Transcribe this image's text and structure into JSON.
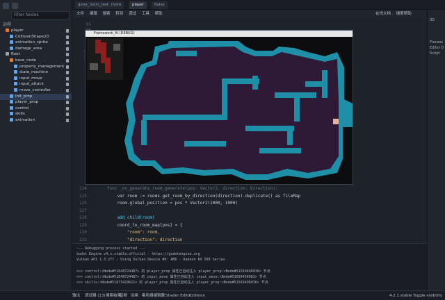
{
  "scene_panel": {
    "filter_placeholder": "Filter Nodes",
    "title": "运程",
    "nodes": [
      {
        "label": "player",
        "color": "#e07b39"
      },
      {
        "label": "CollisionShape2D",
        "color": "#6aa2e6"
      },
      {
        "label": "animation_sprite",
        "color": "#6aa2e6"
      },
      {
        "label": "damage_area",
        "color": "#6aa2e6"
      },
      {
        "label": "Root",
        "color": "#9aa4b1"
      },
      {
        "label": "base_node",
        "color": "#e07b39"
      },
      {
        "label": "property_management",
        "color": "#6aa2e6"
      },
      {
        "label": "state_machine",
        "color": "#6aa2e6"
      },
      {
        "label": "input_move",
        "color": "#6aa2e6"
      },
      {
        "label": "input_attack",
        "color": "#6aa2e6"
      },
      {
        "label": "move_controller",
        "color": "#6aa2e6"
      },
      {
        "label": "init_prop",
        "color": "#6aa2e6"
      },
      {
        "label": "player_prop",
        "color": "#6aa2e6"
      },
      {
        "label": "control",
        "color": "#6aa2e6"
      },
      {
        "label": "skills",
        "color": "#6aa2e6"
      },
      {
        "label": "animation",
        "color": "#6aa2e6"
      }
    ]
  },
  "tabs": [
    "gene_room_test",
    "room",
    "player",
    "Rules"
  ],
  "menu": [
    "文件",
    "编辑",
    "搜索",
    "转到",
    "调试",
    "工具",
    "帮助"
  ],
  "right_actions": [
    "在线文档",
    "搜索帮助"
  ],
  "game_window": {
    "title": "Framework_AI (DEBUG)"
  },
  "code": {
    "lines": [
      {
        "n": "124",
        "text": "func _on_generate_room_generate(pos: Vector2, direction: Direction):",
        "color": "#6b7480"
      },
      {
        "n": "125",
        "text": "    var room := rooms.get_room_by_direction(direction).duplicate() as TileMap",
        "color": "#c9d1d9"
      },
      {
        "n": "126",
        "text": "    room.global_position = pos * Vector2(1000, 1000)",
        "color": "#c9d1d9"
      },
      {
        "n": "127",
        "text": "",
        "color": "#c9d1d9"
      },
      {
        "n": "128",
        "text": "    add_child(room)",
        "color": "#5cc7e8"
      },
      {
        "n": "129",
        "text": "    coord_to_room_map[pos] = {",
        "color": "#c9d1d9"
      },
      {
        "n": "130",
        "text": "        \"room\": room,",
        "color": "#e6c07b"
      },
      {
        "n": "131",
        "text": "        \"direction\": direction",
        "color": "#e6c07b"
      },
      {
        "n": "132",
        "text": "    }",
        "color": "#c9d1d9"
      }
    ],
    "gutter_top": [
      "95",
      "96",
      "97",
      "98",
      "99",
      "100",
      "101"
    ]
  },
  "output": {
    "lines": [
      "--- Debugging process started ---",
      "Godot Engine v4.x.stable.official - https://godotengine.org",
      "Vulkan API 1.3.277 - Using Vulkan Device #0: AMD - Radeon RX 580 Series",
      "",
      ">>> control:<Node#51648724487> 的 player_prop 属性已自动注入 player_prop:<Node#51569496036> 节点",
      ">>> control:<Node#51648724487> 的 input_move 属性已自动注入 input_move:<Node#51609456083> 节点",
      ">>> skills:<Node#51673429621> 的 player_prop 属性已自动注入 player_prop:<Node#51569496036> 节点"
    ]
  },
  "status": {
    "items": [
      "输出",
      "调试器 (13)",
      "搜索结果",
      "音频",
      "动画",
      "着色器编辑器",
      "Shader Editor",
      "Collision"
    ],
    "version": "4.2.1.stable",
    "toggle": "Toggle visibility"
  },
  "inspector": {
    "items": [
      "3D",
      "Process",
      "Editor D",
      "Script"
    ]
  }
}
